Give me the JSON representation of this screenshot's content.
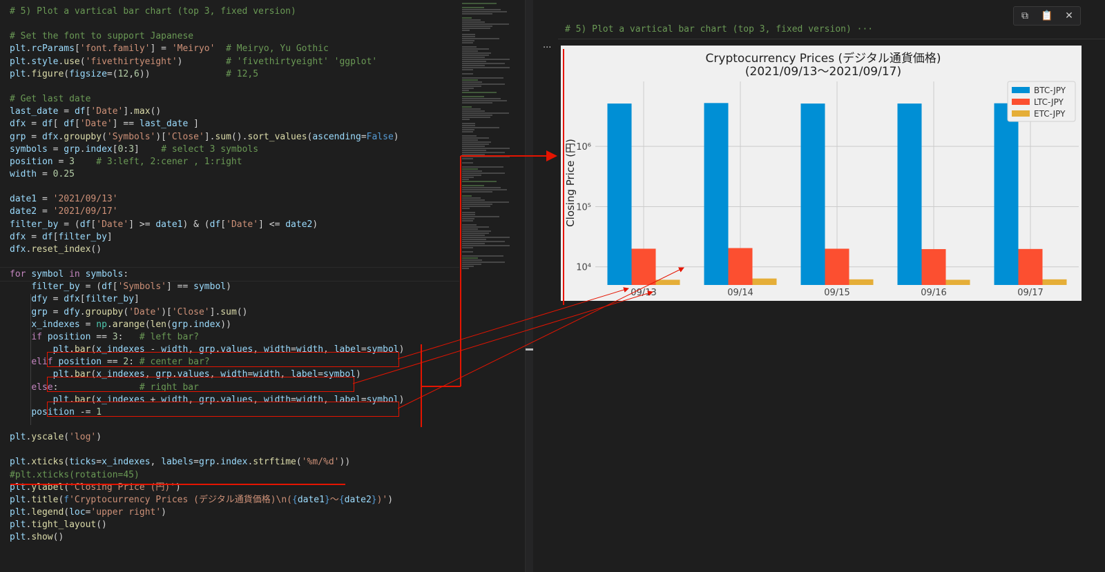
{
  "editor": {
    "lines": [
      [
        [
          "c",
          "# 5) Plot a vartical bar chart (top 3, fixed version)"
        ]
      ],
      [],
      [
        [
          "c",
          "# Set the font to support Japanese"
        ]
      ],
      [
        [
          "v",
          "plt"
        ],
        [
          "p",
          "."
        ],
        [
          "v",
          "rcParams"
        ],
        [
          "p",
          "["
        ],
        [
          "s",
          "'font.family'"
        ],
        [
          "p",
          "] = "
        ],
        [
          "s",
          "'Meiryo'"
        ],
        [
          "p",
          "  "
        ],
        [
          "c",
          "# Meiryo, Yu Gothic"
        ]
      ],
      [
        [
          "v",
          "plt"
        ],
        [
          "p",
          "."
        ],
        [
          "v",
          "style"
        ],
        [
          "p",
          "."
        ],
        [
          "f",
          "use"
        ],
        [
          "p",
          "("
        ],
        [
          "s",
          "'fivethirtyeight'"
        ],
        [
          "p",
          ")        "
        ],
        [
          "c",
          "# 'fivethirtyeight' 'ggplot'"
        ]
      ],
      [
        [
          "v",
          "plt"
        ],
        [
          "p",
          "."
        ],
        [
          "f",
          "figure"
        ],
        [
          "p",
          "("
        ],
        [
          "v",
          "figsize"
        ],
        [
          "p",
          "=("
        ],
        [
          "n",
          "12"
        ],
        [
          "p",
          ","
        ],
        [
          "n",
          "6"
        ],
        [
          "p",
          "))              "
        ],
        [
          "c",
          "# 12,5"
        ]
      ],
      [],
      [
        [
          "c",
          "# Get last date"
        ]
      ],
      [
        [
          "v",
          "last_date"
        ],
        [
          "p",
          " = "
        ],
        [
          "v",
          "df"
        ],
        [
          "p",
          "["
        ],
        [
          "s",
          "'Date'"
        ],
        [
          "p",
          "]."
        ],
        [
          "f",
          "max"
        ],
        [
          "p",
          "()"
        ]
      ],
      [
        [
          "v",
          "dfx"
        ],
        [
          "p",
          " = "
        ],
        [
          "v",
          "df"
        ],
        [
          "p",
          "[ "
        ],
        [
          "v",
          "df"
        ],
        [
          "p",
          "["
        ],
        [
          "s",
          "'Date'"
        ],
        [
          "p",
          "] == "
        ],
        [
          "v",
          "last_date"
        ],
        [
          "p",
          " ]"
        ]
      ],
      [
        [
          "v",
          "grp"
        ],
        [
          "p",
          " = "
        ],
        [
          "v",
          "dfx"
        ],
        [
          "p",
          "."
        ],
        [
          "f",
          "groupby"
        ],
        [
          "p",
          "("
        ],
        [
          "s",
          "'Symbols'"
        ],
        [
          "p",
          ")["
        ],
        [
          "s",
          "'Close'"
        ],
        [
          "p",
          "]."
        ],
        [
          "f",
          "sum"
        ],
        [
          "p",
          "()."
        ],
        [
          "f",
          "sort_values"
        ],
        [
          "p",
          "("
        ],
        [
          "v",
          "ascending"
        ],
        [
          "p",
          "="
        ],
        [
          "b",
          "False"
        ],
        [
          "p",
          ")"
        ]
      ],
      [
        [
          "v",
          "symbols"
        ],
        [
          "p",
          " = "
        ],
        [
          "v",
          "grp"
        ],
        [
          "p",
          "."
        ],
        [
          "v",
          "index"
        ],
        [
          "p",
          "["
        ],
        [
          "n",
          "0"
        ],
        [
          "p",
          ":"
        ],
        [
          "n",
          "3"
        ],
        [
          "p",
          "]    "
        ],
        [
          "c",
          "# select 3 symbols"
        ]
      ],
      [
        [
          "v",
          "position"
        ],
        [
          "p",
          " = "
        ],
        [
          "n",
          "3"
        ],
        [
          "p",
          "    "
        ],
        [
          "c",
          "# 3:left, 2:cener , 1:right"
        ]
      ],
      [
        [
          "v",
          "width"
        ],
        [
          "p",
          " = "
        ],
        [
          "n",
          "0.25"
        ]
      ],
      [],
      [
        [
          "v",
          "date1"
        ],
        [
          "p",
          " = "
        ],
        [
          "s",
          "'2021/09/13'"
        ]
      ],
      [
        [
          "v",
          "date2"
        ],
        [
          "p",
          " = "
        ],
        [
          "s",
          "'2021/09/17'"
        ]
      ],
      [
        [
          "v",
          "filter_by"
        ],
        [
          "p",
          " = ("
        ],
        [
          "v",
          "df"
        ],
        [
          "p",
          "["
        ],
        [
          "s",
          "'Date'"
        ],
        [
          "p",
          "] >= "
        ],
        [
          "v",
          "date1"
        ],
        [
          "p",
          ") & ("
        ],
        [
          "v",
          "df"
        ],
        [
          "p",
          "["
        ],
        [
          "s",
          "'Date'"
        ],
        [
          "p",
          "] <= "
        ],
        [
          "v",
          "date2"
        ],
        [
          "p",
          ")"
        ]
      ],
      [
        [
          "v",
          "dfx"
        ],
        [
          "p",
          " = "
        ],
        [
          "v",
          "df"
        ],
        [
          "p",
          "["
        ],
        [
          "v",
          "filter_by"
        ],
        [
          "p",
          "]"
        ]
      ],
      [
        [
          "v",
          "dfx"
        ],
        [
          "p",
          "."
        ],
        [
          "f",
          "reset_index"
        ],
        [
          "p",
          "()"
        ]
      ],
      [],
      [
        [
          "k",
          "for"
        ],
        [
          "p",
          " "
        ],
        [
          "v",
          "symbol"
        ],
        [
          "p",
          " "
        ],
        [
          "k",
          "in"
        ],
        [
          "p",
          " "
        ],
        [
          "v",
          "symbols"
        ],
        [
          "p",
          ":"
        ]
      ],
      [
        [
          "p",
          "    "
        ],
        [
          "v",
          "filter_by"
        ],
        [
          "p",
          " = ("
        ],
        [
          "v",
          "df"
        ],
        [
          "p",
          "["
        ],
        [
          "s",
          "'Symbols'"
        ],
        [
          "p",
          "] == "
        ],
        [
          "v",
          "symbol"
        ],
        [
          "p",
          ")"
        ]
      ],
      [
        [
          "p",
          "    "
        ],
        [
          "v",
          "dfy"
        ],
        [
          "p",
          " = "
        ],
        [
          "v",
          "dfx"
        ],
        [
          "p",
          "["
        ],
        [
          "v",
          "filter_by"
        ],
        [
          "p",
          "]"
        ]
      ],
      [
        [
          "p",
          "    "
        ],
        [
          "v",
          "grp"
        ],
        [
          "p",
          " = "
        ],
        [
          "v",
          "dfy"
        ],
        [
          "p",
          "."
        ],
        [
          "f",
          "groupby"
        ],
        [
          "p",
          "("
        ],
        [
          "s",
          "'Date'"
        ],
        [
          "p",
          ")["
        ],
        [
          "s",
          "'Close'"
        ],
        [
          "p",
          "]."
        ],
        [
          "f",
          "sum"
        ],
        [
          "p",
          "()"
        ]
      ],
      [
        [
          "p",
          "    "
        ],
        [
          "v",
          "x_indexes"
        ],
        [
          "p",
          " = "
        ],
        [
          "cl",
          "np"
        ],
        [
          "p",
          "."
        ],
        [
          "f",
          "arange"
        ],
        [
          "p",
          "("
        ],
        [
          "f",
          "len"
        ],
        [
          "p",
          "("
        ],
        [
          "v",
          "grp"
        ],
        [
          "p",
          "."
        ],
        [
          "v",
          "index"
        ],
        [
          "p",
          "))"
        ]
      ],
      [
        [
          "p",
          "    "
        ],
        [
          "k",
          "if"
        ],
        [
          "p",
          " "
        ],
        [
          "v",
          "position"
        ],
        [
          "p",
          " == "
        ],
        [
          "n",
          "3"
        ],
        [
          "p",
          ":   "
        ],
        [
          "c",
          "# left bar?"
        ]
      ],
      [
        [
          "p",
          "        "
        ],
        [
          "v",
          "plt"
        ],
        [
          "p",
          "."
        ],
        [
          "f",
          "bar"
        ],
        [
          "p",
          "("
        ],
        [
          "v",
          "x_indexes"
        ],
        [
          "p",
          " - "
        ],
        [
          "v",
          "width"
        ],
        [
          "p",
          ", "
        ],
        [
          "v",
          "grp"
        ],
        [
          "p",
          "."
        ],
        [
          "v",
          "values"
        ],
        [
          "p",
          ", "
        ],
        [
          "v",
          "width"
        ],
        [
          "p",
          "="
        ],
        [
          "v",
          "width"
        ],
        [
          "p",
          ", "
        ],
        [
          "v",
          "label"
        ],
        [
          "p",
          "="
        ],
        [
          "v",
          "symbol"
        ],
        [
          "p",
          ")"
        ]
      ],
      [
        [
          "p",
          "    "
        ],
        [
          "k",
          "elif"
        ],
        [
          "p",
          " "
        ],
        [
          "v",
          "position"
        ],
        [
          "p",
          " == "
        ],
        [
          "n",
          "2"
        ],
        [
          "p",
          ": "
        ],
        [
          "c",
          "# center bar?"
        ]
      ],
      [
        [
          "p",
          "        "
        ],
        [
          "v",
          "plt"
        ],
        [
          "p",
          "."
        ],
        [
          "f",
          "bar"
        ],
        [
          "p",
          "("
        ],
        [
          "v",
          "x_indexes"
        ],
        [
          "p",
          ", "
        ],
        [
          "v",
          "grp"
        ],
        [
          "p",
          "."
        ],
        [
          "v",
          "values"
        ],
        [
          "p",
          ", "
        ],
        [
          "v",
          "width"
        ],
        [
          "p",
          "="
        ],
        [
          "v",
          "width"
        ],
        [
          "p",
          ", "
        ],
        [
          "v",
          "label"
        ],
        [
          "p",
          "="
        ],
        [
          "v",
          "symbol"
        ],
        [
          "p",
          ")"
        ]
      ],
      [
        [
          "p",
          "    "
        ],
        [
          "k",
          "else"
        ],
        [
          "p",
          ":               "
        ],
        [
          "c",
          "# right bar"
        ]
      ],
      [
        [
          "p",
          "        "
        ],
        [
          "v",
          "plt"
        ],
        [
          "p",
          "."
        ],
        [
          "f",
          "bar"
        ],
        [
          "p",
          "("
        ],
        [
          "v",
          "x_indexes"
        ],
        [
          "p",
          " + "
        ],
        [
          "v",
          "width"
        ],
        [
          "p",
          ", "
        ],
        [
          "v",
          "grp"
        ],
        [
          "p",
          "."
        ],
        [
          "v",
          "values"
        ],
        [
          "p",
          ", "
        ],
        [
          "v",
          "width"
        ],
        [
          "p",
          "="
        ],
        [
          "v",
          "width"
        ],
        [
          "p",
          ", "
        ],
        [
          "v",
          "label"
        ],
        [
          "p",
          "="
        ],
        [
          "v",
          "symbol"
        ],
        [
          "p",
          ")"
        ]
      ],
      [
        [
          "p",
          "    "
        ],
        [
          "v",
          "position"
        ],
        [
          "p",
          " -= "
        ],
        [
          "n",
          "1"
        ]
      ],
      [],
      [
        [
          "v",
          "plt"
        ],
        [
          "p",
          "."
        ],
        [
          "f",
          "yscale"
        ],
        [
          "p",
          "("
        ],
        [
          "s",
          "'log'"
        ],
        [
          "p",
          ")"
        ]
      ],
      [],
      [
        [
          "v",
          "plt"
        ],
        [
          "p",
          "."
        ],
        [
          "f",
          "xticks"
        ],
        [
          "p",
          "("
        ],
        [
          "v",
          "ticks"
        ],
        [
          "p",
          "="
        ],
        [
          "v",
          "x_indexes"
        ],
        [
          "p",
          ", "
        ],
        [
          "v",
          "labels"
        ],
        [
          "p",
          "="
        ],
        [
          "v",
          "grp"
        ],
        [
          "p",
          "."
        ],
        [
          "v",
          "index"
        ],
        [
          "p",
          "."
        ],
        [
          "f",
          "strftime"
        ],
        [
          "p",
          "("
        ],
        [
          "s",
          "'%m/%d'"
        ],
        [
          "p",
          "))"
        ]
      ],
      [
        [
          "c",
          "#plt.xticks(rotation=45)"
        ]
      ],
      [
        [
          "v",
          "plt"
        ],
        [
          "p",
          "."
        ],
        [
          "f",
          "ylabel"
        ],
        [
          "p",
          "("
        ],
        [
          "s",
          "'Closing Price (円)'"
        ],
        [
          "p",
          ")"
        ]
      ],
      [
        [
          "v",
          "plt"
        ],
        [
          "p",
          "."
        ],
        [
          "f",
          "title"
        ],
        [
          "p",
          "("
        ],
        [
          "b",
          "f"
        ],
        [
          "s",
          "'Cryptocurrency Prices (デジタル通貨価格)\\n("
        ],
        [
          "b",
          "{"
        ],
        [
          "v",
          "date1"
        ],
        [
          "b",
          "}"
        ],
        [
          "s",
          "～"
        ],
        [
          "b",
          "{"
        ],
        [
          "v",
          "date2"
        ],
        [
          "b",
          "}"
        ],
        [
          "s",
          ")'"
        ],
        [
          "p",
          ")"
        ]
      ],
      [
        [
          "v",
          "plt"
        ],
        [
          "p",
          "."
        ],
        [
          "f",
          "legend"
        ],
        [
          "p",
          "("
        ],
        [
          "v",
          "loc"
        ],
        [
          "p",
          "="
        ],
        [
          "s",
          "'upper right'"
        ],
        [
          "p",
          ")"
        ]
      ],
      [
        [
          "v",
          "plt"
        ],
        [
          "p",
          "."
        ],
        [
          "f",
          "tight_layout"
        ],
        [
          "p",
          "()"
        ]
      ],
      [
        [
          "v",
          "plt"
        ],
        [
          "p",
          "."
        ],
        [
          "f",
          "show"
        ],
        [
          "p",
          "()"
        ]
      ]
    ]
  },
  "output": {
    "cell_header": "# 5) Plot a vartical bar chart (top 3, fixed version) ···",
    "ellipsis": "···",
    "toolbar_icons": [
      "copy-icon",
      "paste-icon",
      "close-icon"
    ]
  },
  "chart_data": {
    "type": "bar",
    "title": "Cryptocurrency Prices (デジタル通貨価格)",
    "subtitle": "(2021/09/13～2021/09/17)",
    "xlabel": "",
    "ylabel": "Closing Price (円)",
    "yscale": "log",
    "ylim": [
      5000,
      12000000
    ],
    "yticks": [
      10000,
      100000,
      1000000
    ],
    "ytick_labels": [
      "10⁴",
      "10⁵",
      "10⁶"
    ],
    "categories": [
      "09/13",
      "09/14",
      "09/15",
      "09/16",
      "09/17"
    ],
    "series": [
      {
        "name": "BTC-JPY",
        "color": "#008fd5",
        "values": [
          5150000,
          5250000,
          5150000,
          5150000,
          5200000
        ]
      },
      {
        "name": "LTC-JPY",
        "color": "#fc4f30",
        "values": [
          20000,
          20500,
          20000,
          19700,
          19800
        ]
      },
      {
        "name": "ETC-JPY",
        "color": "#e5ae38",
        "values": [
          6100,
          6400,
          6200,
          6100,
          6200
        ]
      }
    ],
    "legend_loc": "upper right",
    "grid": true
  }
}
